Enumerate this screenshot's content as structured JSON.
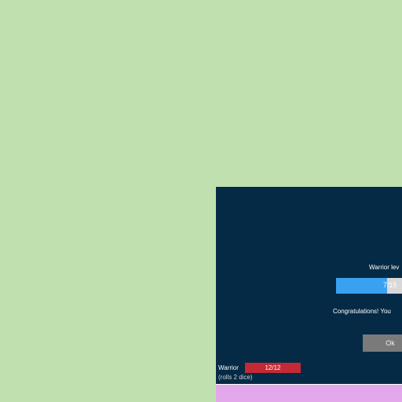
{
  "dialog": {
    "title": "Warrior lev",
    "xp_text": "7/15",
    "xp_progress": 0.72,
    "message": "Congratulations! You",
    "ok_label": "Ok"
  },
  "unit": {
    "name": "Warrior",
    "hp_text": "12/12",
    "hp_progress": 1.0,
    "sub_text": "(rolls 2 dice)"
  },
  "colors": {
    "background": "#c1e0b0",
    "dialog_bg": "#042a45",
    "xp_fill": "#3aa1f0",
    "hp_fill": "#c42a35",
    "button_bg": "#7a7a7a",
    "panel_bg": "#e2a8ea"
  }
}
